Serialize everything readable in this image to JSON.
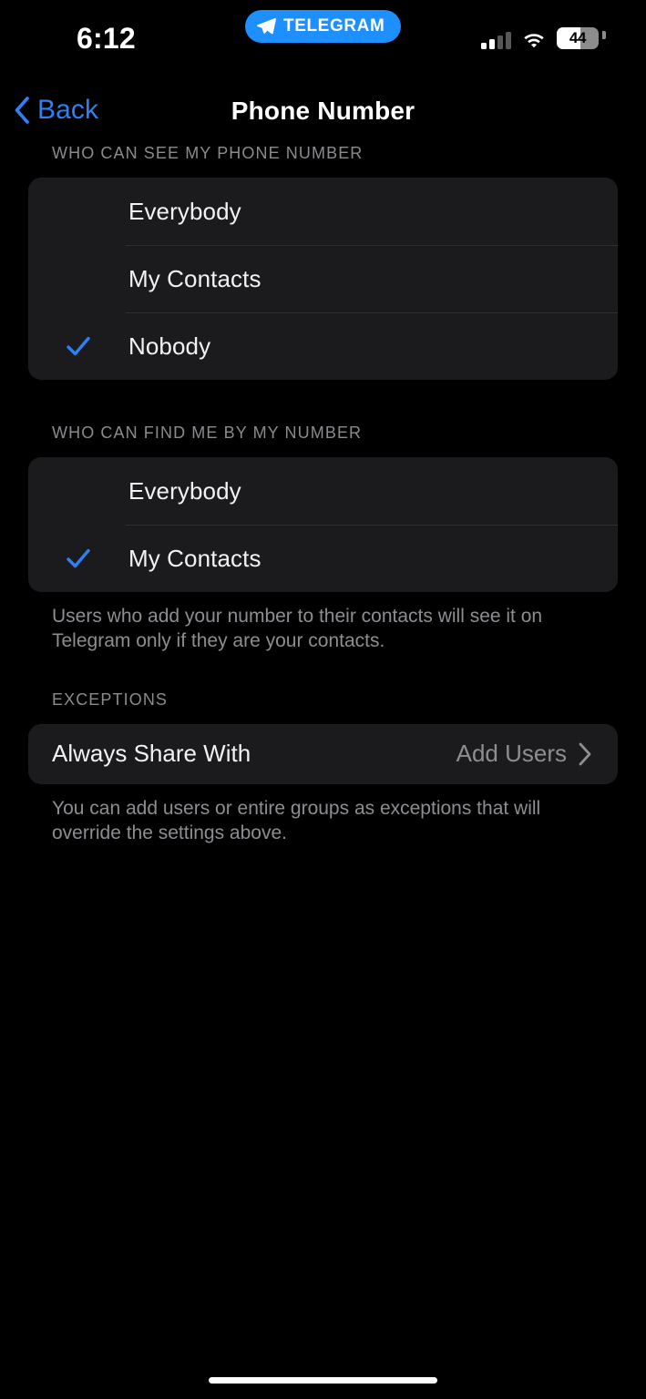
{
  "status_bar": {
    "time": "6:12",
    "pill": {
      "icon": "paper-plane-icon",
      "label": "TELEGRAM",
      "color": "#1e8fff"
    },
    "signal_bars_active": 2,
    "signal_bars_total": 4,
    "wifi": "wifi-icon",
    "battery_level": "44"
  },
  "nav": {
    "back_label": "Back",
    "back_icon": "chevron-left-icon",
    "title": "Phone Number",
    "accent_color": "#2f7ff5"
  },
  "sections": [
    {
      "header": "WHO CAN SEE MY PHONE NUMBER",
      "options": [
        {
          "label": "Everybody",
          "checked": false
        },
        {
          "label": "My Contacts",
          "checked": false
        },
        {
          "label": "Nobody",
          "checked": true
        }
      ],
      "footnote": ""
    },
    {
      "header": "WHO CAN FIND ME BY MY NUMBER",
      "options": [
        {
          "label": "Everybody",
          "checked": false
        },
        {
          "label": "My Contacts",
          "checked": true
        }
      ],
      "footnote": "Users who add your number to their contacts will see it on Telegram only if they are your contacts."
    }
  ],
  "exceptions": {
    "header": "EXCEPTIONS",
    "row_label": "Always Share With",
    "row_value": "Add Users",
    "chevron": "chevron-right-icon",
    "footnote": "You can add users or entire groups as exceptions that will override the settings above."
  },
  "colors": {
    "background": "#000000",
    "card": "#1b1b1d",
    "separator": "#2e2e31",
    "primary_text": "#f2f2f2",
    "secondary_text": "#8d8d92",
    "check_blue": "#2f7ff5"
  }
}
